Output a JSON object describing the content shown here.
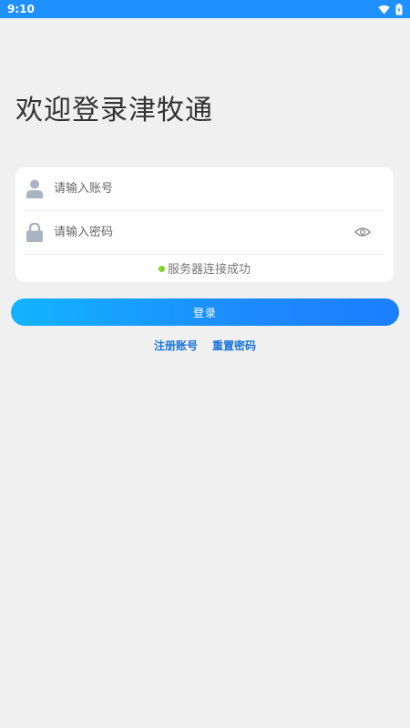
{
  "status_bar": {
    "time": "9:10",
    "icons": [
      "wifi-icon",
      "battery-icon"
    ]
  },
  "title": "欢迎登录津牧通",
  "form": {
    "account_placeholder": "请输入账号",
    "password_placeholder": "请输入密码",
    "account_icon": "user-icon",
    "password_icon": "lock-icon",
    "toggle_icon": "eye-icon",
    "server_status": "服务器连接成功"
  },
  "login_label": "登录",
  "links": {
    "register": "注册账号",
    "reset_password": "重置密码"
  },
  "colors": {
    "status_bar": "#1e90ff",
    "accent": "#1a73d9",
    "status_ok": "#7ed321",
    "background": "#f0f0f0"
  }
}
